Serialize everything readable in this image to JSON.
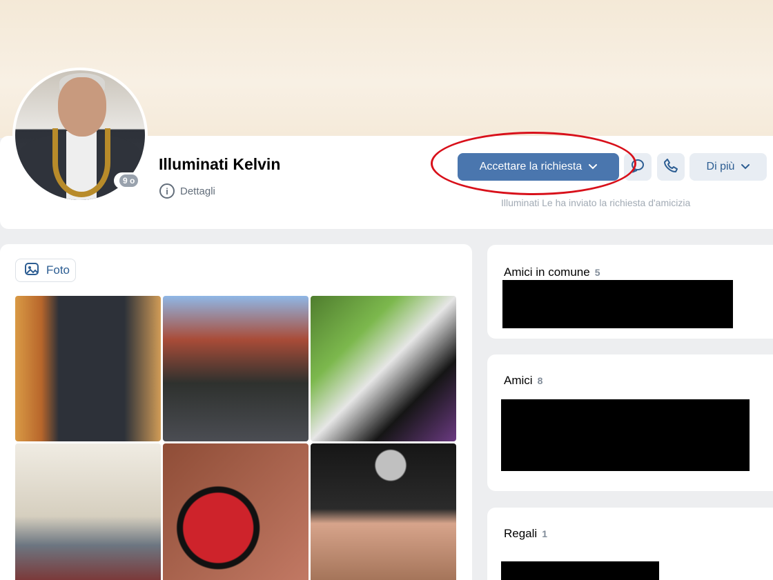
{
  "profile": {
    "name": "Illuminati Kelvin",
    "details_label": "Dettagli",
    "online_badge": "9 o"
  },
  "actions": {
    "accept_label": "Accettare la richiesta",
    "more_label": "Di più",
    "request_text": "Illuminati Le ha inviato la richiesta d'amicizia"
  },
  "photos": {
    "tab_label": "Foto",
    "items": [
      "photo-1",
      "photo-2",
      "photo-3",
      "photo-4",
      "photo-5",
      "photo-6"
    ]
  },
  "sidebar": {
    "mutual": {
      "title": "Amici in comune",
      "count": "5"
    },
    "friends": {
      "title": "Amici",
      "count": "8"
    },
    "gifts": {
      "title": "Regali",
      "count": "1"
    }
  },
  "colors": {
    "accent": "#4a76ae",
    "highlight": "#d8101a",
    "link": "#2c5d92"
  },
  "icons": [
    "info-icon",
    "chevron-down-icon",
    "message-icon",
    "phone-icon",
    "image-icon"
  ]
}
